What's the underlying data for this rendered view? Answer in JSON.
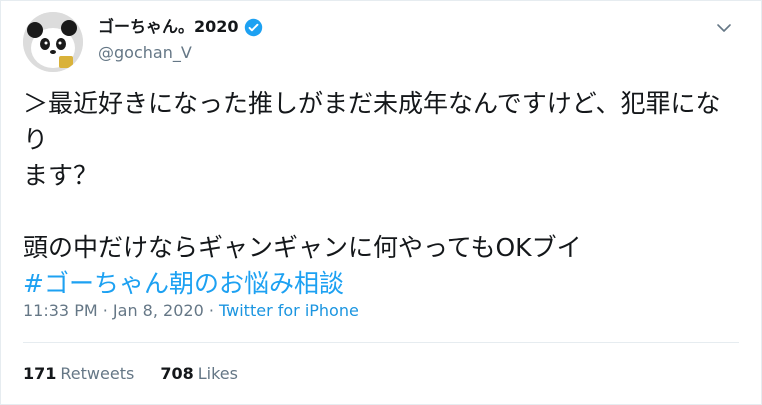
{
  "user": {
    "display_name": "ゴーちゃん。2020",
    "handle": "@gochan_V",
    "verified_icon": "verified-badge-icon",
    "avatar_icon": "panda-avatar"
  },
  "tweet": {
    "line1": "＞最近好きになった推しがまだ未成年なんですけど、犯罪になり",
    "line2": "ます？",
    "line3": "頭の中だけならギャンギャンに何やってもOKブイ",
    "hashtag": "#ゴーちゃん朝のお悩み相談"
  },
  "meta": {
    "time": "11:33 PM",
    "sep1": " · ",
    "date": "Jan 8, 2020",
    "sep2": " · ",
    "source": "Twitter for iPhone"
  },
  "stats": {
    "retweets_count": "171",
    "retweets_label": "Retweets",
    "likes_count": "708",
    "likes_label": "Likes"
  },
  "colors": {
    "link": "#1da1f2",
    "muted": "#657786",
    "text": "#14171a"
  }
}
